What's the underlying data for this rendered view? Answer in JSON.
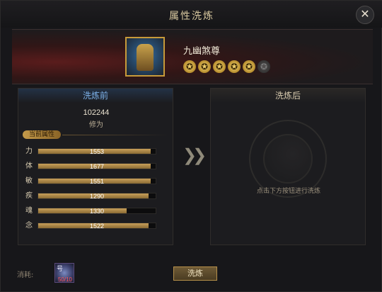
{
  "window": {
    "title": "属性洗炼",
    "close_label": "✕"
  },
  "hero": {
    "name": "九幽煞尊",
    "stars_total": 6,
    "stars_filled": 5,
    "star_glyph": "✪"
  },
  "before": {
    "header": "洗炼前",
    "power_value": "102244",
    "power_label": "修为",
    "section_tag": "当前属性",
    "stats": [
      {
        "label": "力",
        "value": "1553",
        "fill": 0.96
      },
      {
        "label": "体",
        "value": "1677",
        "fill": 0.96
      },
      {
        "label": "敏",
        "value": "1551",
        "fill": 0.96
      },
      {
        "label": "疾",
        "value": "1290",
        "fill": 0.94
      },
      {
        "label": "魂",
        "value": "1330",
        "fill": 0.75
      },
      {
        "label": "念",
        "value": "1522",
        "fill": 0.94
      }
    ]
  },
  "after": {
    "header": "洗炼后",
    "hint": "点击下方按钮进行洗炼"
  },
  "arrows": "❯❯",
  "cost": {
    "label": "消耗:",
    "item_glyph": "号",
    "quantity": "50/10"
  },
  "action": {
    "button_label": "洗炼"
  },
  "colors": {
    "accent_gold": "#c9a05a",
    "header_blue": "#7db2ea",
    "qty_red": "#ff5555"
  }
}
